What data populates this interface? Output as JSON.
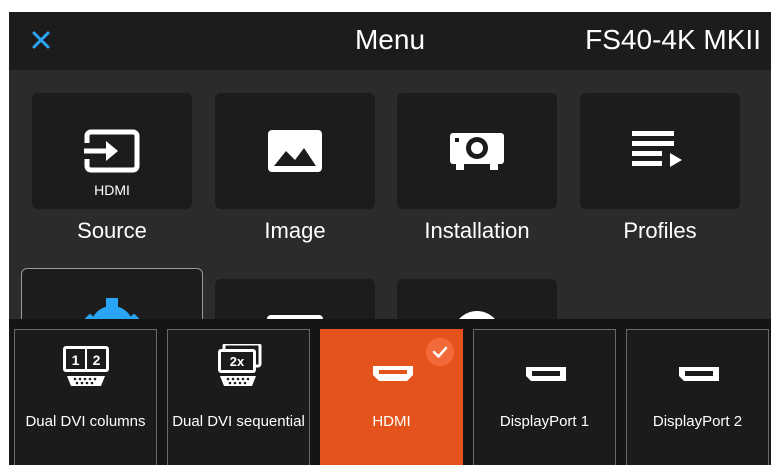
{
  "header": {
    "close_icon": "close-icon",
    "title": "Menu",
    "model": "FS40-4K MKII"
  },
  "menu": {
    "tiles": [
      {
        "label": "Source",
        "sub": "HDMI",
        "icon": "input-icon"
      },
      {
        "label": "Image",
        "icon": "image-icon"
      },
      {
        "label": "Installation",
        "icon": "projector-icon"
      },
      {
        "label": "Profiles",
        "icon": "playlist-icon"
      }
    ],
    "row2_icons": [
      "gear-icon",
      "display-icon",
      "circle-icon"
    ]
  },
  "sources": {
    "items": [
      {
        "label": "Dual DVI columns",
        "icon": "dual-dvi-columns-icon",
        "badge": [
          "1",
          "2"
        ]
      },
      {
        "label": "Dual DVI sequential",
        "icon": "dual-dvi-sequential-icon",
        "badge": "2x"
      },
      {
        "label": "HDMI",
        "icon": "hdmi-port-icon",
        "selected": true
      },
      {
        "label": "DisplayPort 1",
        "icon": "displayport-icon"
      },
      {
        "label": "DisplayPort 2",
        "icon": "displayport-icon"
      }
    ]
  },
  "colors": {
    "accent_blue": "#2aa4f4",
    "selected_orange": "#e4531c",
    "background": "#2b2b2b"
  }
}
